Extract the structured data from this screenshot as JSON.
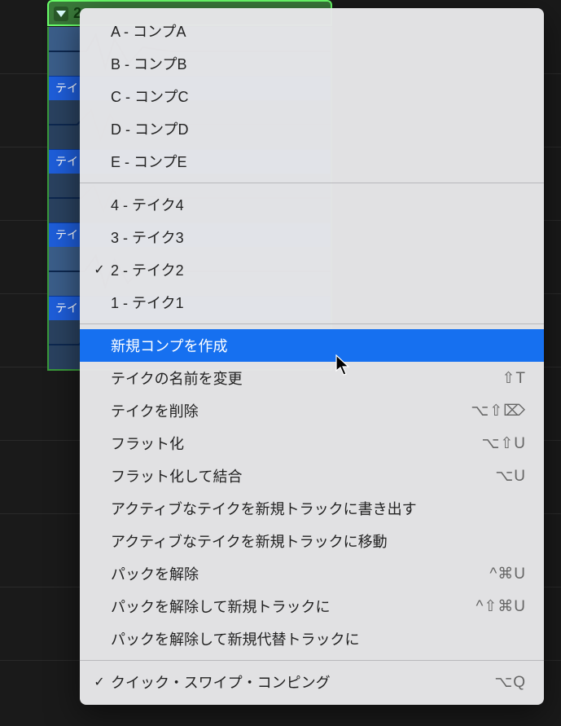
{
  "track_header": {
    "number": "2"
  },
  "takes_bg": [
    {
      "label": "テイ"
    },
    {
      "label": "テイ"
    },
    {
      "label": "テイ"
    },
    {
      "label": "テイ"
    }
  ],
  "menu": {
    "comps": [
      {
        "label": "A - コンプA",
        "checked": false
      },
      {
        "label": "B - コンプB",
        "checked": false
      },
      {
        "label": "C - コンプC",
        "checked": false
      },
      {
        "label": "D - コンプD",
        "checked": false
      },
      {
        "label": "E - コンプE",
        "checked": false
      }
    ],
    "takes": [
      {
        "label": "4 - テイク4",
        "checked": false
      },
      {
        "label": "3 - テイク3",
        "checked": false
      },
      {
        "label": "2 - テイク2",
        "checked": true
      },
      {
        "label": "1 - テイク1",
        "checked": false
      }
    ],
    "actions": [
      {
        "label": "新規コンプを作成",
        "shortcut": "",
        "highlight": true
      },
      {
        "label": "テイクの名前を変更",
        "shortcut": "⇧T"
      },
      {
        "label": "テイクを削除",
        "shortcut": "⌥⇧⌦"
      },
      {
        "label": "フラット化",
        "shortcut": "⌥⇧U"
      },
      {
        "label": "フラット化して結合",
        "shortcut": "⌥U"
      },
      {
        "label": "アクティブなテイクを新規トラックに書き出す",
        "shortcut": ""
      },
      {
        "label": "アクティブなテイクを新規トラックに移動",
        "shortcut": ""
      },
      {
        "label": "パックを解除",
        "shortcut": "^⌘U"
      },
      {
        "label": "パックを解除して新規トラックに",
        "shortcut": "^⇧⌘U"
      },
      {
        "label": "パックを解除して新規代替トラックに",
        "shortcut": ""
      }
    ],
    "footer": [
      {
        "label": "クイック・スワイプ・コンピング",
        "shortcut": "⌥Q",
        "checked": true
      }
    ]
  }
}
